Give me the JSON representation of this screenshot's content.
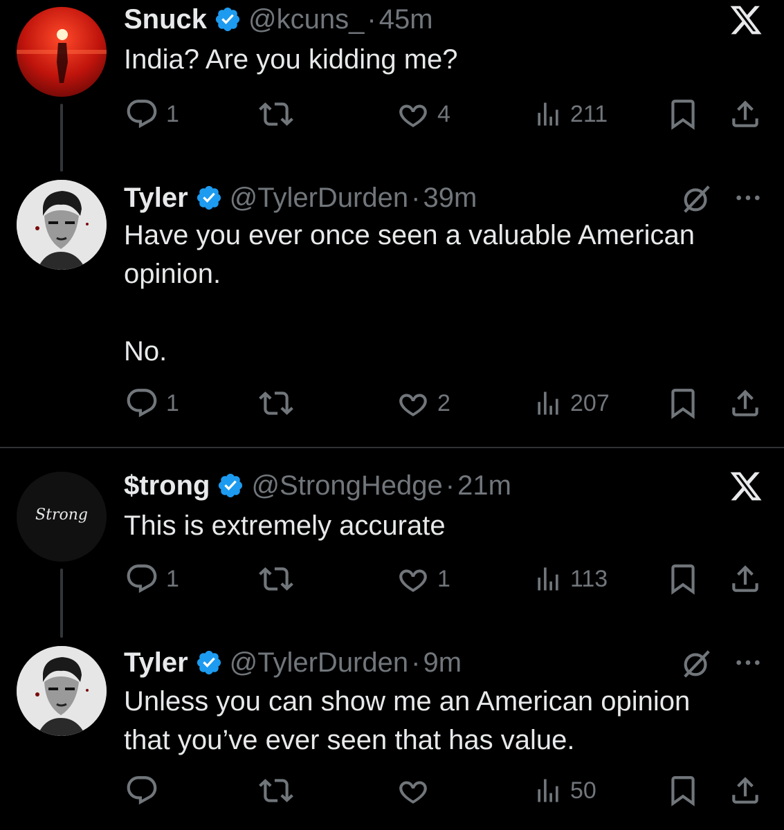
{
  "tweets": [
    {
      "name": "Snuck",
      "handle": "@kcuns_",
      "time": "45m",
      "text": "India? Are you kidding me?",
      "replies": "1",
      "likes": "4",
      "views": "211",
      "corner_icon": "x-logo-icon"
    },
    {
      "name": "Tyler",
      "handle": "@TylerDurden",
      "time": "39m",
      "text": "Have you ever once seen a valuable American\nopinion.\n\nNo.",
      "replies": "1",
      "likes": "2",
      "views": "207",
      "corner_icon": "grok-icon"
    },
    {
      "name": "$trong",
      "handle": "@StrongHedge",
      "time": "21m",
      "text": "This is extremely accurate",
      "replies": "1",
      "likes": "1",
      "views": "113",
      "avatar_text": "Strong",
      "corner_icon": "x-logo-icon"
    },
    {
      "name": "Tyler",
      "handle": "@TylerDurden",
      "time": "9m",
      "text": "Unless you can show me an American opinion\nthat you’ve ever seen that has value.",
      "replies": "",
      "likes": "",
      "views": "50",
      "corner_icon": "grok-icon"
    }
  ],
  "separator": "·",
  "colors": {
    "background": "#000000",
    "text": "#e7e9ea",
    "muted": "#71767b",
    "verified": "#1d9bf0",
    "divider": "#2f3336"
  }
}
